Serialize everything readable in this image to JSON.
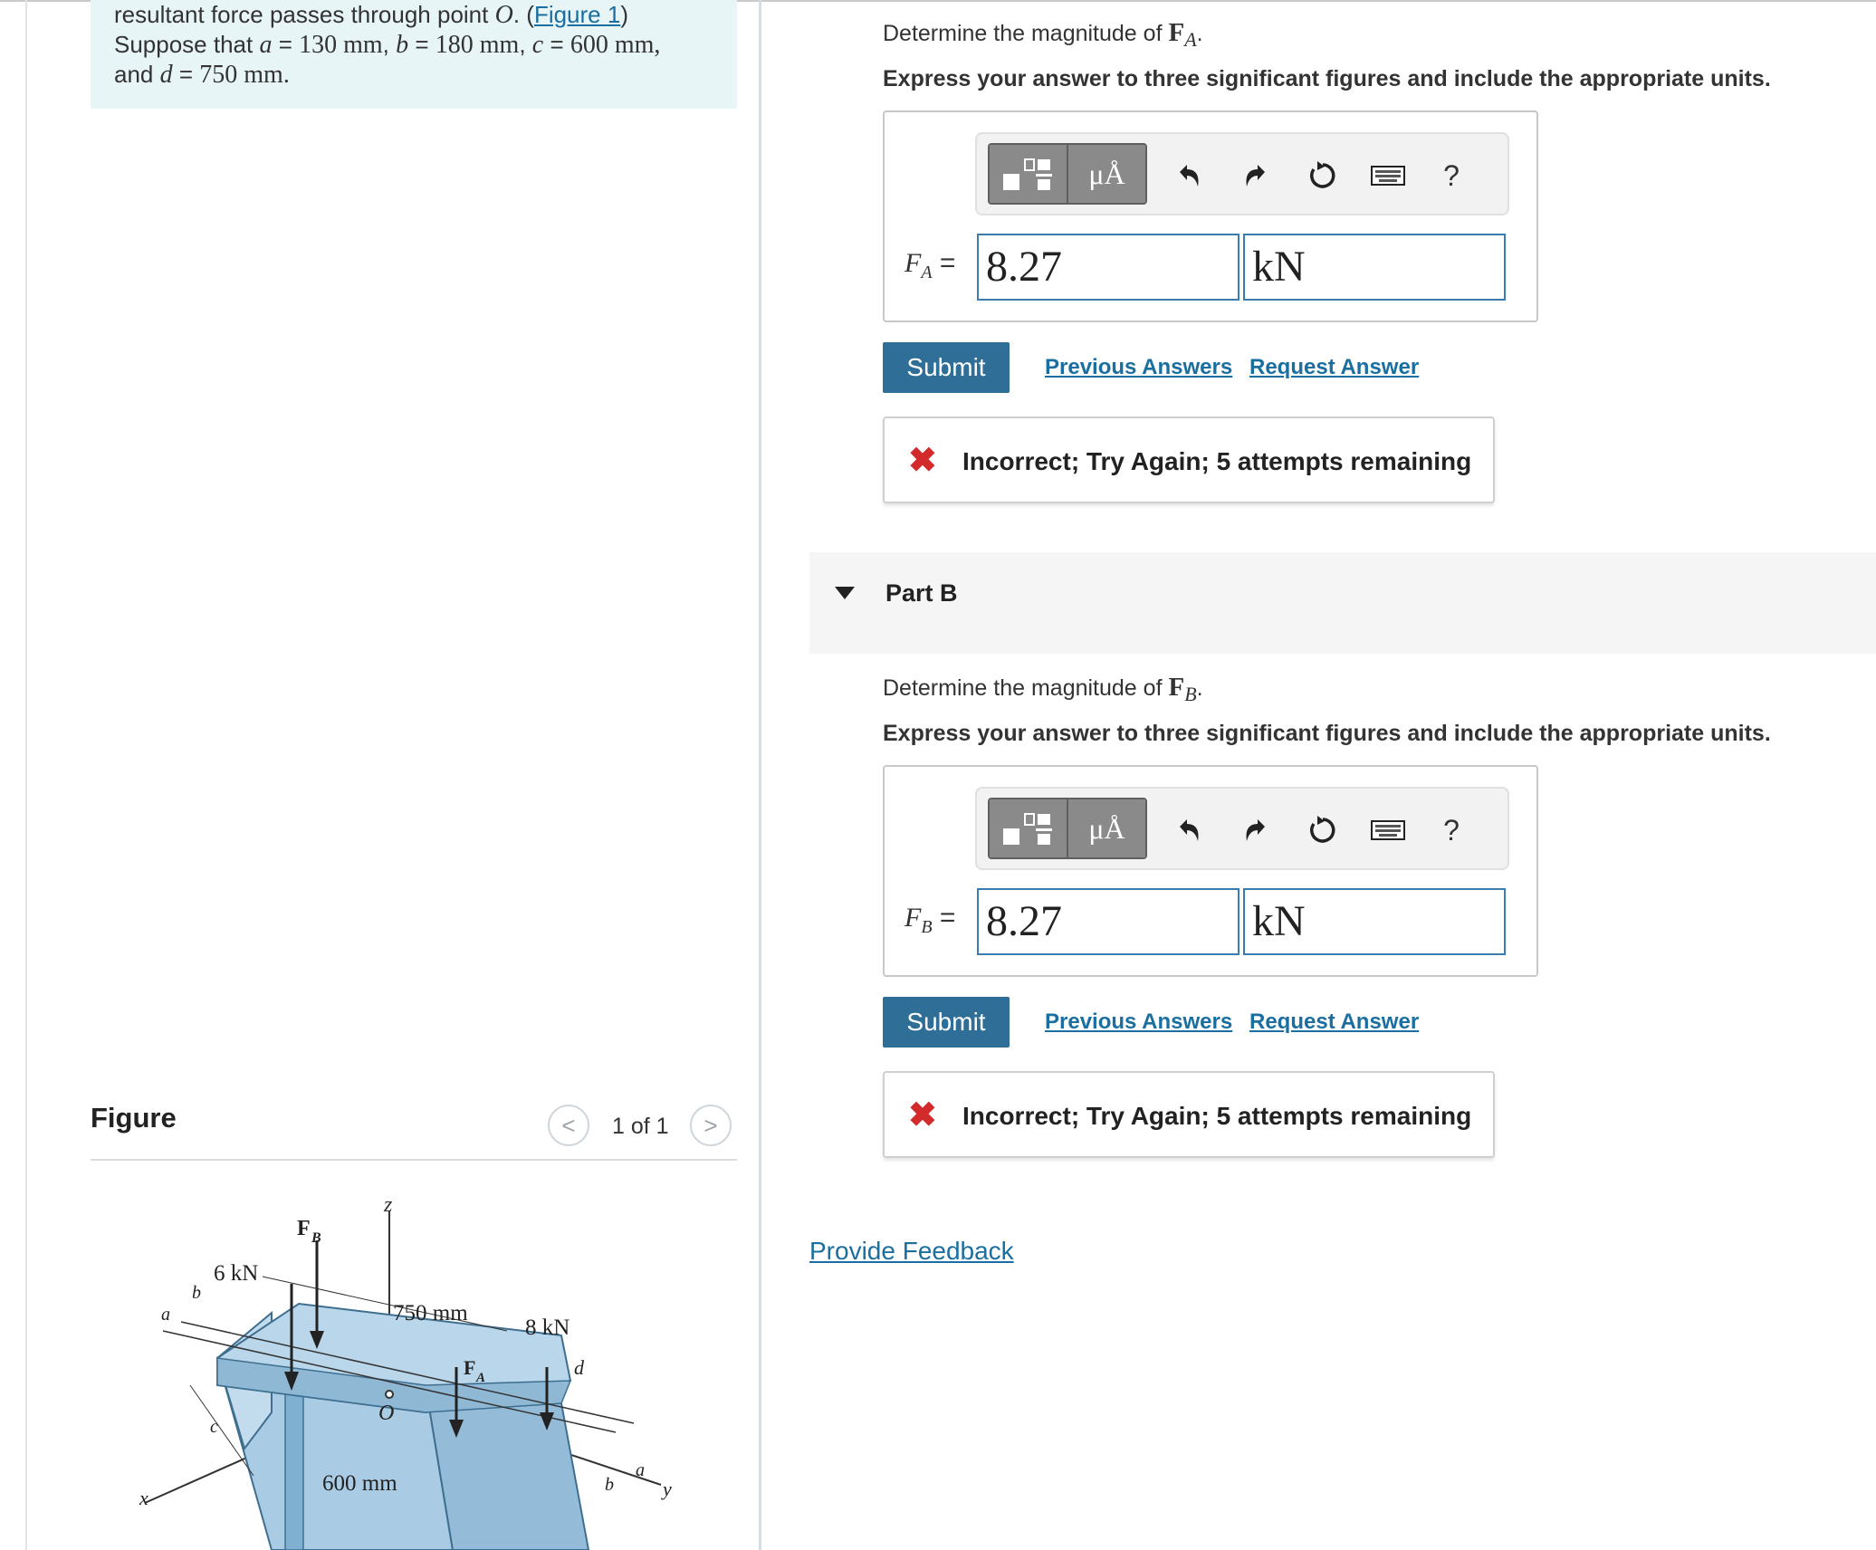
{
  "problem": {
    "line1_prefix": "resultant force passes through point ",
    "point": "O",
    "line1_suffix": ". (",
    "figure_link": "Figure 1",
    "line1_close": ")",
    "line2_prefix": "Suppose that ",
    "a_var": "a",
    "a_val": "130 mm",
    "b_var": "b",
    "b_val": "180 mm",
    "c_var": "c",
    "c_val": "600 mm",
    "line3_prefix": "and ",
    "d_var": "d",
    "d_val": "750 mm",
    "eq": " = ",
    "comma": ", ",
    "period": "."
  },
  "figure": {
    "heading": "Figure",
    "counter": "1 of 1",
    "prev_glyph": "<",
    "next_glyph": ">",
    "labels": {
      "z": "z",
      "fb": "F",
      "fb_sub": "B",
      "fa": "F",
      "fa_sub": "A",
      "six_kn": "6 kN",
      "eight_kn": "8 kN",
      "dim_750": "750 mm",
      "dim_600": "600 mm",
      "origin": "O",
      "x": "x",
      "y": "y",
      "a_left": "a",
      "b_left": "b",
      "c_left": "c",
      "d_right": "d",
      "a_right": "a",
      "b_right": "b"
    }
  },
  "part_a": {
    "question_prefix": "Determine the magnitude of ",
    "force": "F",
    "force_sub": "A",
    "question_suffix": ".",
    "instruction": "Express your answer to three significant figures and include the appropriate units.",
    "var_label": "F",
    "var_sub": "A",
    "equals": " =",
    "value": "8.27",
    "units": "kN",
    "submit": "Submit",
    "previous_answers": "Previous Answers",
    "request_answer": "Request Answer",
    "feedback_icon": "✖",
    "feedback": "Incorrect; Try Again; 5 attempts remaining"
  },
  "part_b": {
    "title": "Part B",
    "question_prefix": "Determine the magnitude of ",
    "force": "F",
    "force_sub": "B",
    "question_suffix": ".",
    "instruction": "Express your answer to three significant figures and include the appropriate units.",
    "var_label": "F",
    "var_sub": "B",
    "equals": " =",
    "value": "8.27",
    "units": "kN",
    "submit": "Submit",
    "previous_answers": "Previous Answers",
    "request_answer": "Request Answer",
    "feedback_icon": "✖",
    "feedback": "Incorrect; Try Again; 5 attempts remaining"
  },
  "toolbar": {
    "units_label": "μÅ",
    "help_label": "?",
    "icons": [
      "templates-icon",
      "units-icon",
      "undo-icon",
      "redo-icon",
      "reset-icon",
      "keyboard-icon",
      "help-icon"
    ]
  },
  "provide_feedback": "Provide Feedback",
  "colors": {
    "accent": "#2f6e96",
    "link": "#1a6fa0",
    "error": "#d32b2b",
    "problem_bg": "#e8f5f7",
    "beam": "#a9cbe3"
  }
}
